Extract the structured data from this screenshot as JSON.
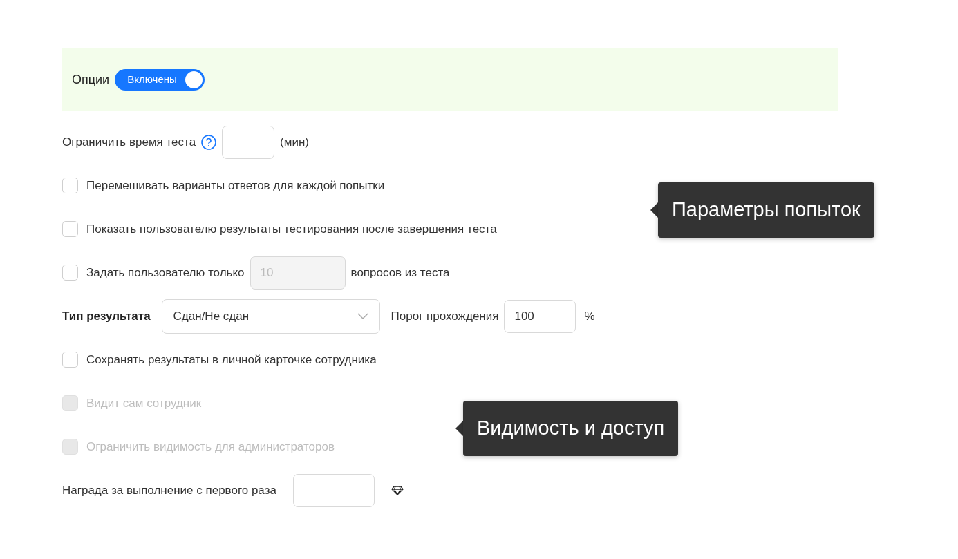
{
  "options": {
    "label": "Опции",
    "switch_label": "Включены",
    "on": true
  },
  "time_limit": {
    "label": "Ограничить время теста",
    "unit": "(мин)"
  },
  "settings": [
    {
      "kind": "checkbox",
      "label": "Перемешивать варианты ответов для каждой попытки",
      "checked": false
    },
    {
      "kind": "checkbox",
      "label": "Показать пользователю результаты тестирования после завершения теста",
      "checked": false
    },
    {
      "kind": "count",
      "label": "Задать пользователю только",
      "value": "10",
      "input_disabled": true,
      "suffix": "вопросов из теста",
      "checked": false
    }
  ],
  "result": {
    "label": "Тип результата",
    "selected_value": "Сдан/Не сдан",
    "threshold_label": "Порог прохождения",
    "threshold_value": "100",
    "unit": "%"
  },
  "visibility": [
    {
      "label": "Сохранять результаты в личной карточке сотрудника",
      "checked": false,
      "disabled": false
    },
    {
      "label": "Видит сам сотрудник",
      "checked": false,
      "disabled": true
    },
    {
      "label": "Ограничить видимость для администраторов",
      "checked": false,
      "disabled": true
    }
  ],
  "reward": {
    "label": "Награда за выполнение с первого раза"
  },
  "callouts": [
    {
      "text": "Параметры попыток"
    },
    {
      "text": "Видимость и доступ"
    }
  ]
}
